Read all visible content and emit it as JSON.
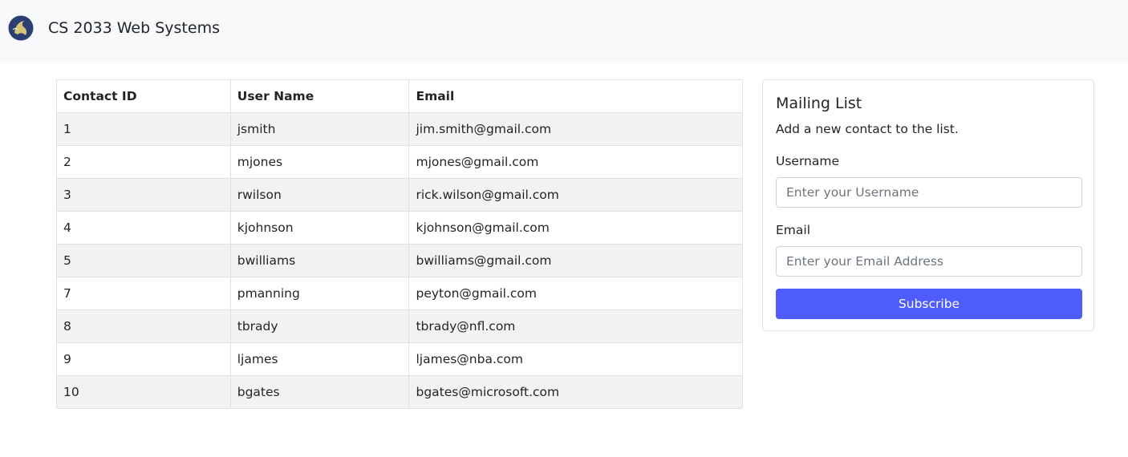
{
  "navbar": {
    "brand": "CS 2033 Web Systems",
    "logo_icon": "eagle-logo-icon",
    "logo_colors": {
      "primary": "#2b3f73",
      "accent": "#d9c27a"
    }
  },
  "table": {
    "headers": [
      "Contact ID",
      "User Name",
      "Email"
    ],
    "rows": [
      [
        "1",
        "jsmith",
        "jim.smith@gmail.com"
      ],
      [
        "2",
        "mjones",
        "mjones@gmail.com"
      ],
      [
        "3",
        "rwilson",
        "rick.wilson@gmail.com"
      ],
      [
        "4",
        "kjohnson",
        "kjohnson@gmail.com"
      ],
      [
        "5",
        "bwilliams",
        "bwilliams@gmail.com"
      ],
      [
        "7",
        "pmanning",
        "peyton@gmail.com"
      ],
      [
        "8",
        "tbrady",
        "tbrady@nfl.com"
      ],
      [
        "9",
        "ljames",
        "ljames@nba.com"
      ],
      [
        "10",
        "bgates",
        "bgates@microsoft.com"
      ]
    ]
  },
  "form": {
    "title": "Mailing List",
    "subtitle": "Add a new contact to the list.",
    "username_label": "Username",
    "username_placeholder": "Enter your Username",
    "username_value": "",
    "email_label": "Email",
    "email_placeholder": "Enter your Email Address",
    "email_value": "",
    "submit_label": "Subscribe",
    "submit_color": "#4d5cfa"
  }
}
